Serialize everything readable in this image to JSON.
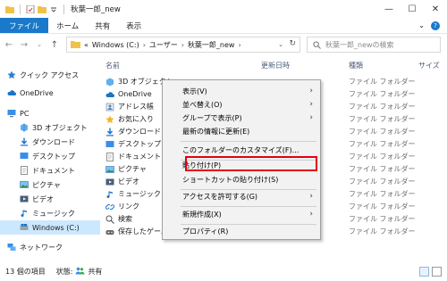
{
  "window": {
    "title": "秋葉一郎_new",
    "controls": {
      "minimize": "—",
      "maximize": "☐",
      "close": "✕"
    }
  },
  "ribbon": {
    "tabs": [
      "ファイル",
      "ホーム",
      "共有",
      "表示"
    ],
    "expand": "⌄",
    "help": "?"
  },
  "nav": {
    "back": "←",
    "forward": "→",
    "recent": "⌄",
    "up": "↑",
    "breadcrumb_prefix": "«",
    "crumbs": [
      "Windows (C:)",
      "ユーザー",
      "秋葉一郎_new"
    ],
    "crumb_separator": "›",
    "dropdown": "⌄",
    "refresh": "↻",
    "search_placeholder": "秋葉一郎_newの検索"
  },
  "sidebar": {
    "items": [
      {
        "label": "クイック アクセス",
        "icon": "star-icon"
      },
      {
        "label": "OneDrive",
        "icon": "cloud-icon"
      },
      {
        "label": "PC",
        "icon": "pc-icon"
      },
      {
        "label": "3D オブジェクト",
        "icon": "cube-icon"
      },
      {
        "label": "ダウンロード",
        "icon": "download-icon"
      },
      {
        "label": "デスクトップ",
        "icon": "desktop-icon"
      },
      {
        "label": "ドキュメント",
        "icon": "document-icon"
      },
      {
        "label": "ピクチャ",
        "icon": "picture-icon"
      },
      {
        "label": "ビデオ",
        "icon": "video-icon"
      },
      {
        "label": "ミュージック",
        "icon": "music-icon"
      },
      {
        "label": "Windows (C:)",
        "icon": "drive-icon"
      },
      {
        "label": "ネットワーク",
        "icon": "network-icon"
      }
    ]
  },
  "columns": {
    "name": "名前",
    "date": "更新日時",
    "type": "種類",
    "size": "サイズ"
  },
  "files": [
    {
      "name": "3D オブジェクト",
      "type": "ファイル フォルダー",
      "icon": "cube-icon"
    },
    {
      "name": "OneDrive",
      "type": "ファイル フォルダー",
      "icon": "cloud-icon"
    },
    {
      "name": "アドレス帳",
      "type": "ファイル フォルダー",
      "icon": "contacts-icon"
    },
    {
      "name": "お気に入り",
      "type": "ファイル フォルダー",
      "icon": "star-icon"
    },
    {
      "name": "ダウンロード",
      "type": "ファイル フォルダー",
      "icon": "download-icon"
    },
    {
      "name": "デスクトップ",
      "type": "ファイル フォルダー",
      "icon": "desktop-icon"
    },
    {
      "name": "ドキュメント",
      "type": "ファイル フォルダー",
      "icon": "document-icon"
    },
    {
      "name": "ピクチャ",
      "type": "ファイル フォルダー",
      "icon": "picture-icon"
    },
    {
      "name": "ビデオ",
      "type": "ファイル フォルダー",
      "icon": "video-icon"
    },
    {
      "name": "ミュージック",
      "type": "ファイル フォルダー",
      "icon": "music-icon"
    },
    {
      "name": "リンク",
      "type": "ファイル フォルダー",
      "icon": "link-icon"
    },
    {
      "name": "検索",
      "type": "ファイル フォルダー",
      "icon": "search-icon"
    },
    {
      "name": "保存したゲーム",
      "type": "ファイル フォルダー",
      "icon": "game-icon"
    }
  ],
  "context_menu": {
    "items": [
      {
        "label": "表示(V)",
        "submenu": "›"
      },
      {
        "label": "並べ替え(O)",
        "submenu": "›"
      },
      {
        "label": "グループで表示(P)",
        "submenu": "›"
      },
      {
        "label": "最新の情報に更新(E)",
        "submenu": ""
      },
      {
        "label": "このフォルダーのカスタマイズ(F)...",
        "submenu": ""
      },
      {
        "label": "貼り付け(P)",
        "submenu": ""
      },
      {
        "label": "ショートカットの貼り付け(S)",
        "submenu": ""
      },
      {
        "label": "アクセスを許可する(G)",
        "submenu": "›"
      },
      {
        "label": "新規作成(X)",
        "submenu": "›"
      },
      {
        "label": "プロパティ(R)",
        "submenu": ""
      }
    ],
    "highlighted": "貼り付け(P)"
  },
  "status": {
    "count": "13 個の項目",
    "state_label": "状態:",
    "state_value": "共有"
  },
  "colors": {
    "accent": "#1979ca",
    "selection": "#cce8ff",
    "highlight_box": "#e4000f",
    "folder": "#f0c24b"
  }
}
